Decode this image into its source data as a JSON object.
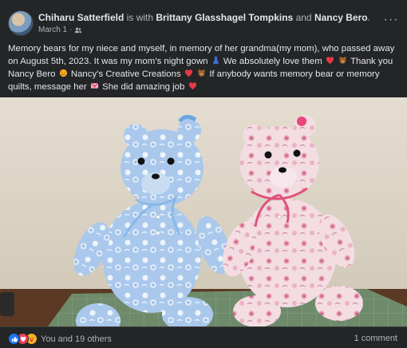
{
  "post": {
    "author": "Chiharu Satterfield",
    "with_text": "is with",
    "tagged_1": "Brittany Glasshagel Tompkins",
    "and_text": "and",
    "tagged_2": "Nancy Bero",
    "period": ".",
    "date": "March 1",
    "dot": "·",
    "audience_icon": "friends-icon",
    "more_label": "···",
    "caption": {
      "p1": "Memory bears for my niece and myself, in memory of her grandma(my mom), who passed away on August 5th, 2023. It was my mom’s night gown",
      "p2": " We absolutely love them",
      "p3": "  Thank you Nancy Bero",
      "p4": " Nancy’s Creative Creations",
      "p5": " If anybody wants memory bear or memory quilts, message her",
      "p6": " She did amazing job"
    },
    "photo_alt": "Two handmade memory teddy bears, one blue floral and one pink floral, sitting on a cutting mat",
    "reactions": {
      "types": [
        "like",
        "love",
        "care"
      ],
      "summary": "You and 19 others"
    },
    "comments_label": "1 comment"
  },
  "colors": {
    "background": "#242526",
    "text_primary": "#e4e6eb",
    "text_secondary": "#b0b3b8",
    "like": "#1877f2",
    "love": "#f33e58",
    "care": "#f7b125"
  }
}
